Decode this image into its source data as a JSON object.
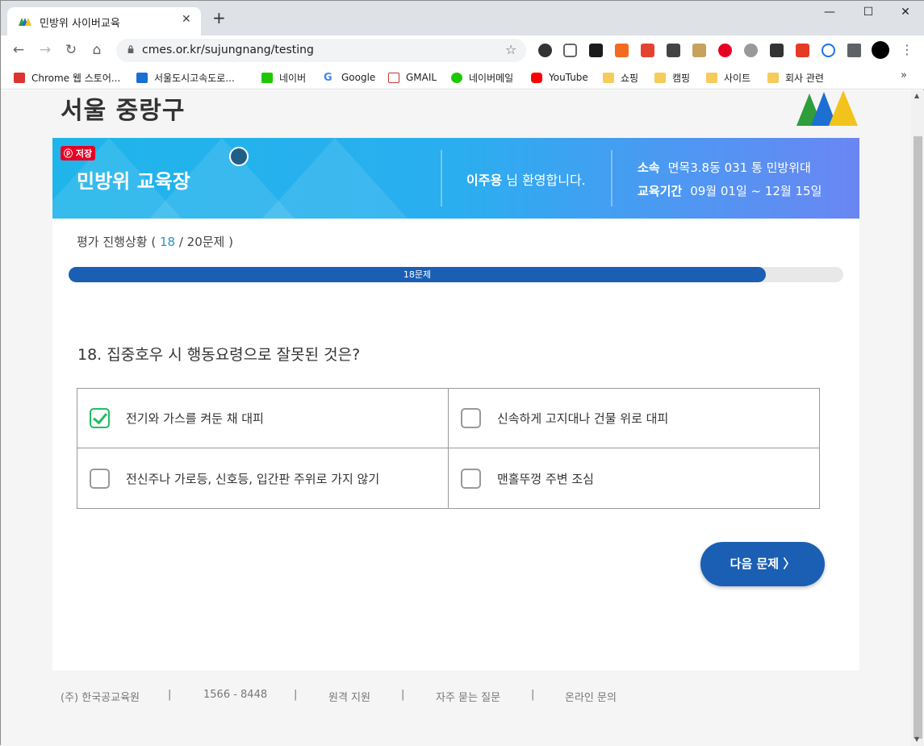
{
  "browser": {
    "tab_title": "민방위 사이버교육",
    "tab_close": "✕",
    "new_tab": "+",
    "win_min": "—",
    "win_max": "☐",
    "win_close": "✕",
    "url": "cmes.or.kr/sujungnang/testing",
    "bookmarks": [
      {
        "label": "Chrome 웹 스토어...",
        "icon": "chrome-store-icon"
      },
      {
        "label": "서울도시고속도로...",
        "icon": "expressway-icon"
      },
      {
        "label": "네이버",
        "icon": "naver-icon"
      },
      {
        "label": "Google",
        "icon": "google-icon"
      },
      {
        "label": "GMAIL",
        "icon": "gmail-icon"
      },
      {
        "label": "네이버메일",
        "icon": "naver-mail-icon"
      },
      {
        "label": "YouTube",
        "icon": "youtube-icon"
      },
      {
        "label": "쇼핑",
        "icon": "folder-icon"
      },
      {
        "label": "캠핑",
        "icon": "folder-icon"
      },
      {
        "label": "사이트",
        "icon": "folder-icon"
      },
      {
        "label": "회사 관련",
        "icon": "folder-icon"
      }
    ],
    "bookmarks_more": "»"
  },
  "page": {
    "region": "서울 중랑구",
    "pin_label": "ⓟ 저장",
    "banner_title": "민방위 교육장",
    "welcome_name": "이주용",
    "welcome_suffix": " 님 환영합니다.",
    "affiliation_label": "소속",
    "affiliation_value": "면목3.8동 031 통 민방위대",
    "period_label": "교육기간",
    "period_value": "09월 01일 ~ 12월 15일",
    "progress_prefix": "평가 진행상황 ( ",
    "progress_current": "18",
    "progress_suffix": " / 20문제 )",
    "progress_fraction": 0.9,
    "progress_bar_label": "18문제",
    "question": "18. 집중호우 시 행동요령으로 잘못된 것은?",
    "options": [
      {
        "label": "전기와 가스를 켜둔 채 대피",
        "checked": true
      },
      {
        "label": "신속하게 고지대나 건물 위로 대피",
        "checked": false
      },
      {
        "label": "전신주나 가로등, 신호등, 입간판 주위로 가지 않기",
        "checked": false
      },
      {
        "label": "맨홀뚜껑 주변 조심",
        "checked": false
      }
    ],
    "next_button": "다음 문제 〉"
  },
  "footer": {
    "company": "(주) 한국공교육원",
    "phone": "1566 - 8448",
    "remote": "원격 지원",
    "faq": "자주 묻는 질문",
    "inquiry": "온라인 문의",
    "sep": "|"
  },
  "colors": {
    "accent": "#1a5fb4",
    "check": "#1fbe60",
    "banner_start": "#1fb5ea",
    "banner_end": "#6a86f3"
  }
}
